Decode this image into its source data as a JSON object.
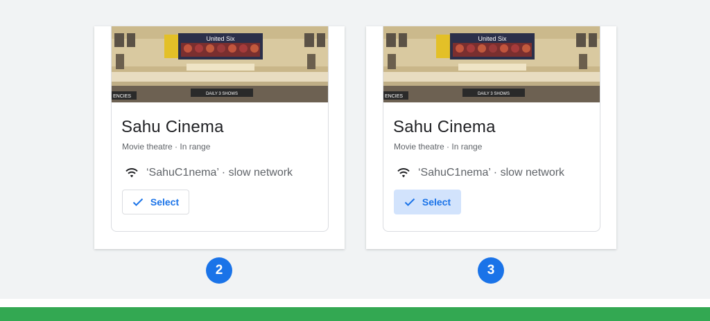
{
  "cards": [
    {
      "title": "Sahu Cinema",
      "subtitle": "Movie theatre · In range",
      "network": "‘SahuC1nema’ · slow network",
      "select_label": "Select",
      "select_style": "outlined",
      "photo_signs": {
        "banner": "United Six",
        "marquee": "DAILY 3 SHOWS",
        "side": "ENCIES"
      }
    },
    {
      "title": "Sahu Cinema",
      "subtitle": "Movie theatre · In range",
      "network": "‘SahuC1nema’ · slow network",
      "select_label": "Select",
      "select_style": "filled",
      "photo_signs": {
        "banner": "United Six",
        "marquee": "DAILY 3 SHOWS",
        "side": "ENCIES"
      }
    }
  ],
  "steps": [
    "2",
    "3"
  ],
  "colors": {
    "accent": "#1a73e8",
    "selected_fill": "#d2e3fc",
    "footer_bar": "#33a852",
    "background": "#f1f3f4"
  },
  "icons": {
    "network": "wifi-icon",
    "select": "check-icon"
  }
}
